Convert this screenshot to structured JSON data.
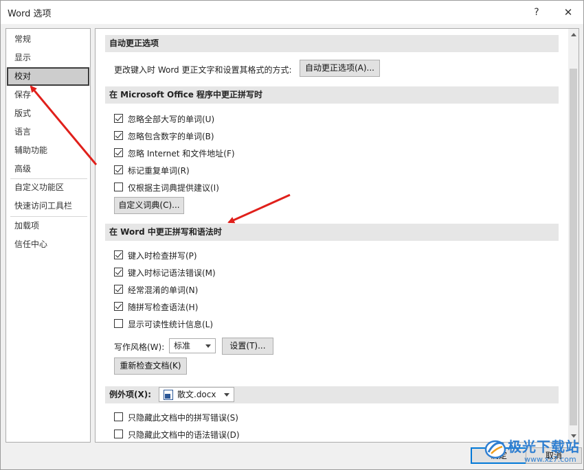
{
  "window": {
    "title": "Word 选项",
    "help": "?",
    "close": "✕"
  },
  "nav": {
    "items": [
      {
        "label": "常规"
      },
      {
        "label": "显示"
      },
      {
        "label": "校对"
      },
      {
        "label": "保存"
      },
      {
        "label": "版式"
      },
      {
        "label": "语言"
      },
      {
        "label": "辅助功能"
      },
      {
        "label": "高级"
      },
      {
        "label": "自定义功能区"
      },
      {
        "label": "快速访问工具栏"
      },
      {
        "label": "加载项"
      },
      {
        "label": "信任中心"
      }
    ],
    "selected": "校对"
  },
  "autocorrect": {
    "heading": "自动更正选项",
    "description": "更改键入时 Word 更正文字和设置其格式的方式:",
    "button": "自动更正选项(A)..."
  },
  "office_spelling": {
    "heading": "在 Microsoft Office 程序中更正拼写时",
    "options": [
      {
        "label": "忽略全部大写的单词(U)",
        "checked": true
      },
      {
        "label": "忽略包含数字的单词(B)",
        "checked": true
      },
      {
        "label": "忽略 Internet 和文件地址(F)",
        "checked": true
      },
      {
        "label": "标记重复单词(R)",
        "checked": true
      },
      {
        "label": "仅根据主词典提供建议(I)",
        "checked": false
      }
    ],
    "custom_dict_button": "自定义词典(C)..."
  },
  "word_spelling": {
    "heading": "在 Word 中更正拼写和语法时",
    "options": [
      {
        "label": "键入时检查拼写(P)",
        "checked": true
      },
      {
        "label": "键入时标记语法错误(M)",
        "checked": true
      },
      {
        "label": "经常混淆的单词(N)",
        "checked": true
      },
      {
        "label": "随拼写检查语法(H)",
        "checked": true
      },
      {
        "label": "显示可读性统计信息(L)",
        "checked": false
      }
    ],
    "writing_style_label": "写作风格(W):",
    "writing_style_value": "标准",
    "settings_button": "设置(T)...",
    "recheck_button": "重新检查文档(K)"
  },
  "exceptions": {
    "label": "例外项(X):",
    "document": "散文.docx",
    "options": [
      {
        "label": "只隐藏此文档中的拼写错误(S)",
        "checked": false
      },
      {
        "label": "只隐藏此文档中的语法错误(D)",
        "checked": false
      }
    ]
  },
  "footer": {
    "ok": "确定",
    "cancel": "取消"
  },
  "watermark": {
    "text": "极光下载站",
    "url": "www.xz7.com"
  },
  "colors": {
    "accent": "#0078d7",
    "arrow": "#e0201b",
    "selected_bg": "#cdcdcd",
    "section_bg": "#e6e6e6",
    "watermark": "#2f7fd1"
  }
}
